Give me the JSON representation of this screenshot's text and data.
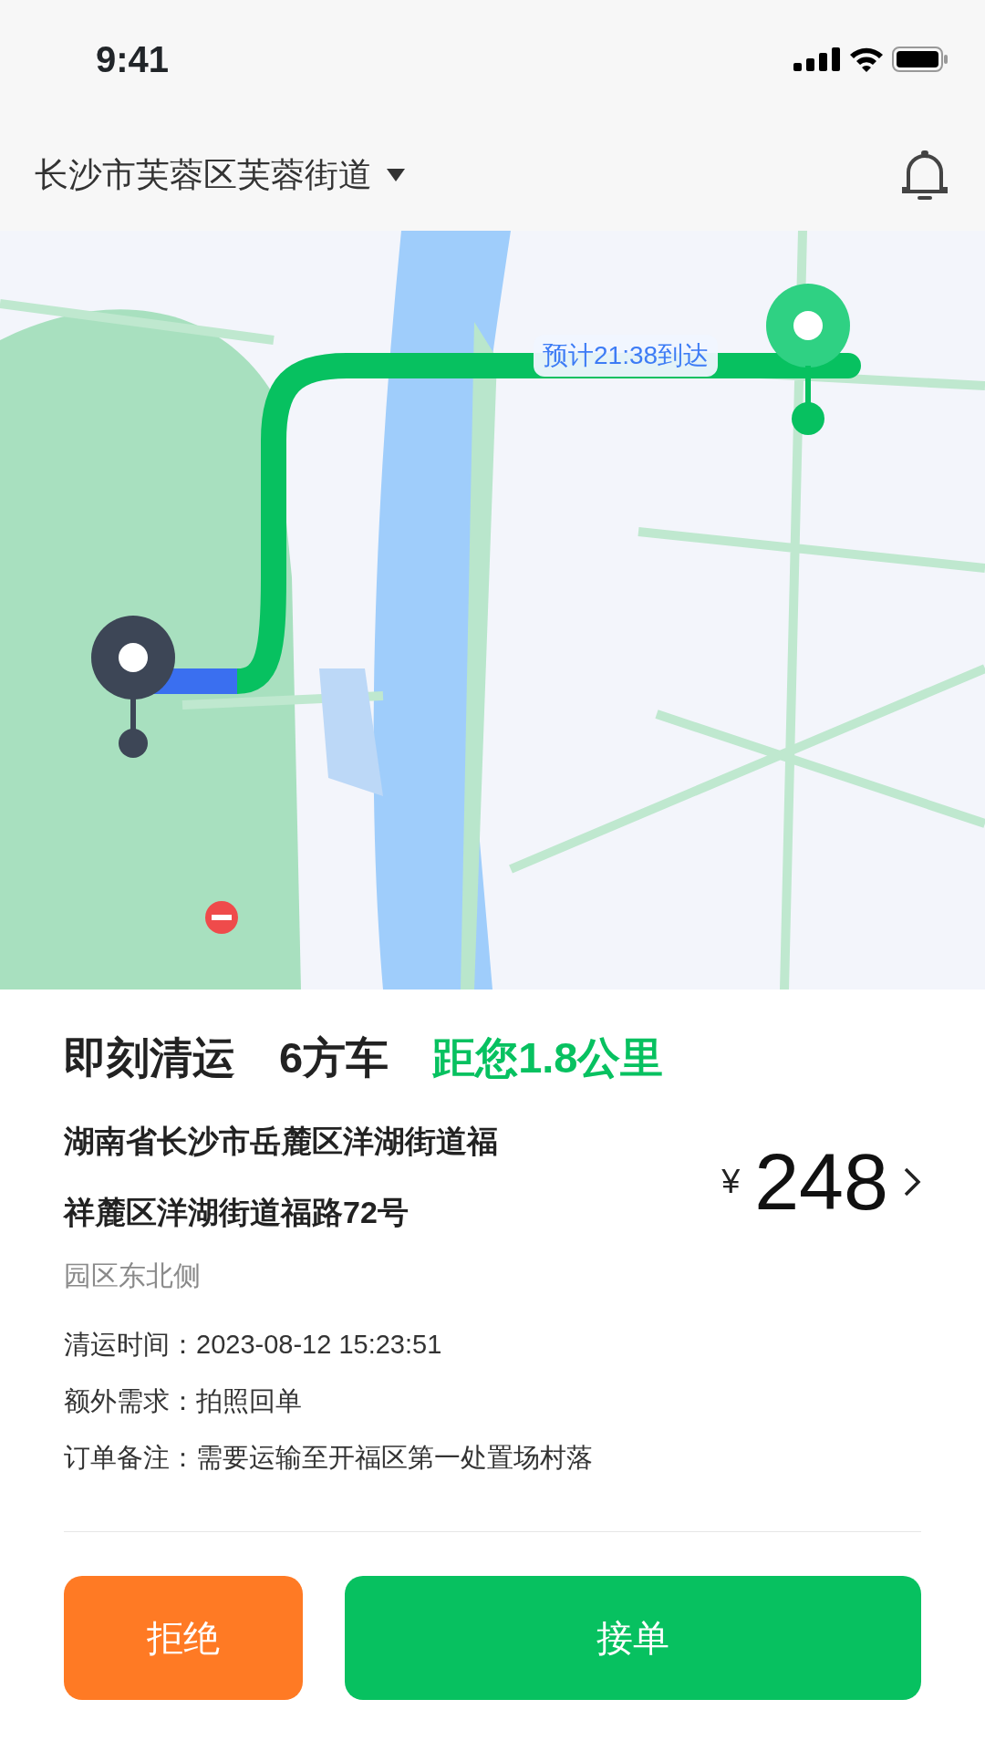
{
  "status_bar": {
    "time": "9:41"
  },
  "header": {
    "location": "长沙市芙蓉区芙蓉街道"
  },
  "map": {
    "eta": "预计21:38到达"
  },
  "order": {
    "type": "即刻清运",
    "vehicle": "6方车",
    "distance": "距您1.8公里",
    "address_lines": [
      "湖南省长沙市岳麓区洋湖街道福",
      "祥麓区洋湖街道福路72号"
    ],
    "area": "园区东北侧",
    "currency": "¥",
    "price": "248",
    "details": [
      {
        "label": "清运时间：",
        "value": "2023-08-12 15:23:51"
      },
      {
        "label": "额外需求：",
        "value": "拍照回单"
      },
      {
        "label": "订单备注：",
        "value": "需要运输至开福区第一处置场村落"
      }
    ]
  },
  "buttons": [
    {
      "kind": "reject",
      "label": "拒绝"
    },
    {
      "kind": "accept",
      "label": "接单"
    }
  ]
}
